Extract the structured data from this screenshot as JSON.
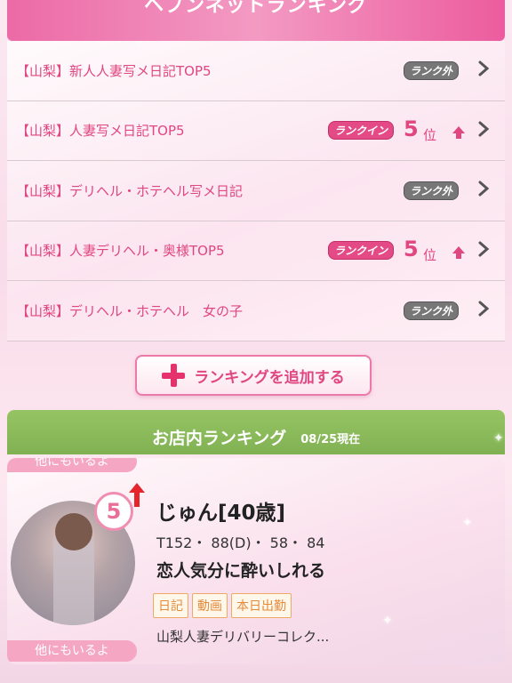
{
  "header": {
    "title": "ヘブンネットランキング"
  },
  "ranking_rows": [
    {
      "label": "【山梨】新人人妻写メ日記TOP5",
      "status": "ランク外",
      "ranked": false
    },
    {
      "label": "【山梨】人妻写メ日記TOP5",
      "status": "ランクイン",
      "ranked": true,
      "rank": "5",
      "unit": "位"
    },
    {
      "label": "【山梨】デリヘル・ホテヘル写メ日記",
      "status": "ランク外",
      "ranked": false
    },
    {
      "label": "【山梨】人妻デリヘル・奥様TOP5",
      "status": "ランクイン",
      "ranked": true,
      "rank": "5",
      "unit": "位"
    },
    {
      "label": "【山梨】デリヘル・ホテヘル　女の子",
      "status": "ランク外",
      "ranked": false
    }
  ],
  "add_button": {
    "label": "ランキングを追加する"
  },
  "store_ranking": {
    "title": "お店内ランキング",
    "date": "08/25現在"
  },
  "girl": {
    "others_label": "他にもいるよ",
    "rank": "5",
    "name": "じゅん[40歳]",
    "stats": "T152・ 88(D)・ 58・ 84",
    "catchphrase": "恋人気分に酔いしれる",
    "tags": [
      "日記",
      "動画",
      "本日出勤"
    ],
    "store": "山梨人妻デリバリーコレク..."
  },
  "colors": {
    "accent_pink": "#e0467f",
    "header_green": "#8bbb5b",
    "tag_orange": "#e58b3c"
  }
}
